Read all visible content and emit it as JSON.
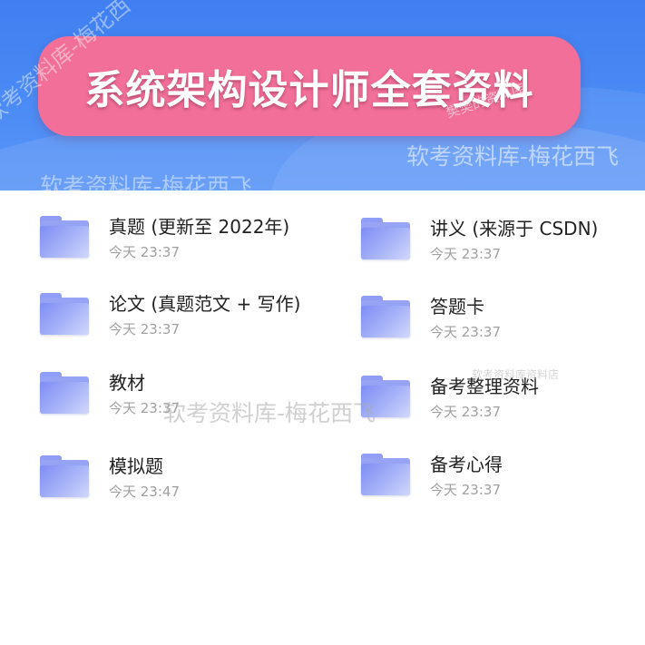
{
  "header": {
    "title": "系统架构设计师全套资料"
  },
  "watermarks": {
    "top_right": "软考资料库-梅花西飞",
    "top_left": "软考资料库-梅花西飞",
    "middle": "软考资料库-梅花西飞",
    "diagonal": "软考资料库-梅花西飞",
    "banner_corner": "樊樊的资料库",
    "small": "软考资料库资料店"
  },
  "items": [
    {
      "name": "真题 (更新至 2022年)",
      "time": "今天 23:37",
      "icon": "folder-icon"
    },
    {
      "name": "讲义 (来源于 CSDN)",
      "time": "今天 23:37",
      "icon": "folder-icon"
    },
    {
      "name": "论文 (真题范文 + 写作)",
      "time": "今天 23:37",
      "icon": "folder-icon"
    },
    {
      "name": "答题卡",
      "time": "今天 23:37",
      "icon": "folder-icon"
    },
    {
      "name": "教材",
      "time": "今天 23:37",
      "icon": "folder-icon"
    },
    {
      "name": "备考整理资料",
      "time": "今天 23:37",
      "icon": "folder-icon"
    },
    {
      "name": "模拟题",
      "time": "今天 23:47",
      "icon": "folder-icon"
    },
    {
      "name": "备考心得",
      "time": "今天 23:37",
      "icon": "folder-icon"
    }
  ],
  "colors": {
    "header_blue": "#4b8bf5",
    "banner_pink": "#f16f98",
    "folder_purple": "#8f9df7"
  }
}
